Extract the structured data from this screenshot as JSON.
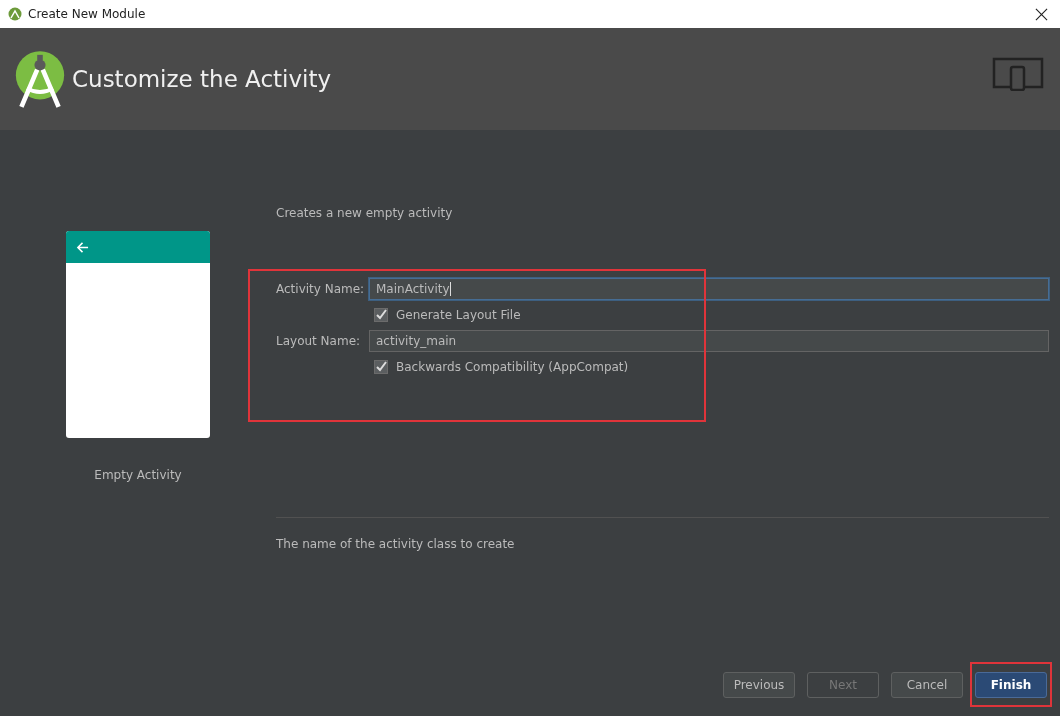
{
  "window": {
    "title": "Create New Module"
  },
  "header": {
    "title": "Customize the Activity"
  },
  "template": {
    "name": "Empty Activity"
  },
  "description": "Creates a new empty activity",
  "form": {
    "highlighted": true,
    "rows": [
      {
        "kind": "field",
        "label": "Activity Name:",
        "value": "MainActivity",
        "focused": true
      },
      {
        "kind": "checkbox",
        "label": "Generate Layout File",
        "checked": true
      },
      {
        "kind": "field",
        "label": "Layout Name:",
        "value": "activity_main",
        "focused": false
      },
      {
        "kind": "checkbox",
        "label": "Backwards Compatibility (AppCompat)",
        "checked": true
      }
    ]
  },
  "hint": "The name of the activity class to create",
  "buttons": [
    {
      "label": "Previous",
      "disabled": false,
      "primary": false,
      "highlighted": false
    },
    {
      "label": "Next",
      "disabled": true,
      "primary": false,
      "highlighted": false
    },
    {
      "label": "Cancel",
      "disabled": false,
      "primary": false,
      "highlighted": false
    },
    {
      "label": "Finish",
      "disabled": false,
      "primary": true,
      "highlighted": true
    }
  ]
}
